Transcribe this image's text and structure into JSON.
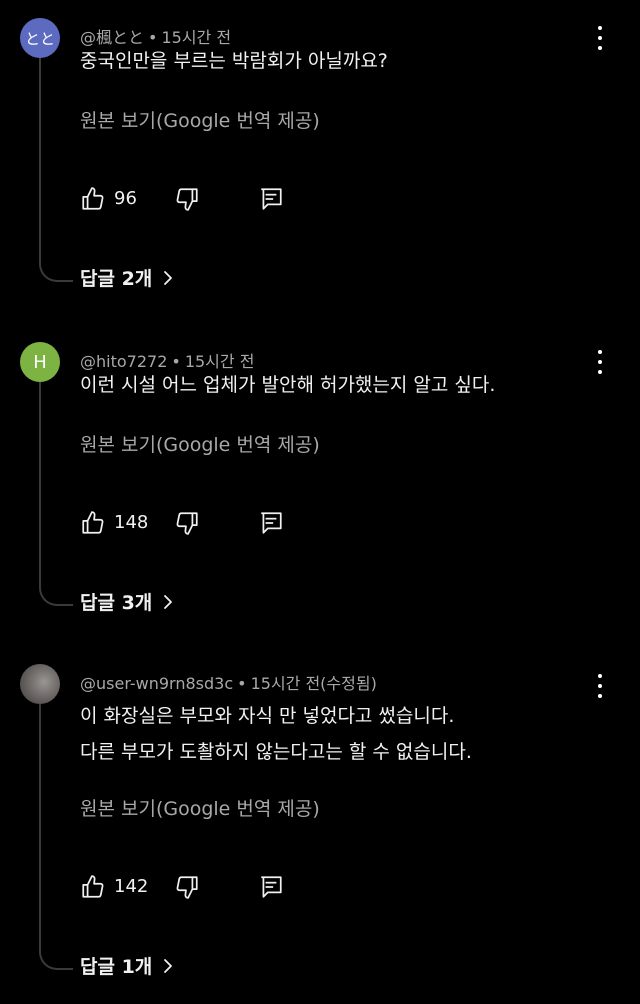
{
  "comments": [
    {
      "avatar_text": "とと",
      "avatar_color": "#5c6bc0",
      "author": "@楓とと",
      "sep": "•",
      "time": "15시간 전",
      "lines": [
        "중국인만을 부르는 박람회가 아닐까요?"
      ],
      "translate_label": "원본 보기(Google 번역 제공)",
      "likes": "96",
      "replies_label": "답글 2개"
    },
    {
      "avatar_text": "H",
      "avatar_color": "#7cb342",
      "author": "@hito7272",
      "sep": "•",
      "time": "15시간 전",
      "lines": [
        "이런 시설 어느 업체가 발안해 허가했는지 알고 싶다."
      ],
      "translate_label": "원본 보기(Google 번역 제공)",
      "likes": "148",
      "replies_label": "답글 3개"
    },
    {
      "avatar_text": "",
      "avatar_color": "#6f6a68",
      "author": "@user-wn9rn8sd3c",
      "sep": "•",
      "time": "15시간 전(수정됨)",
      "lines": [
        "이 화장실은 부모와 자식 만 넣었다고 썼습니다.",
        "다른 부모가 도촬하지 않는다고는 할 수 없습니다."
      ],
      "translate_label": "원본 보기(Google 번역 제공)",
      "likes": "142",
      "replies_label": "답글 1개"
    }
  ],
  "icons": {
    "like": "thumbs-up-icon",
    "dislike": "thumbs-down-icon",
    "reply": "reply-icon",
    "more": "more-vertical-icon",
    "chevron": "chevron-right-icon"
  }
}
